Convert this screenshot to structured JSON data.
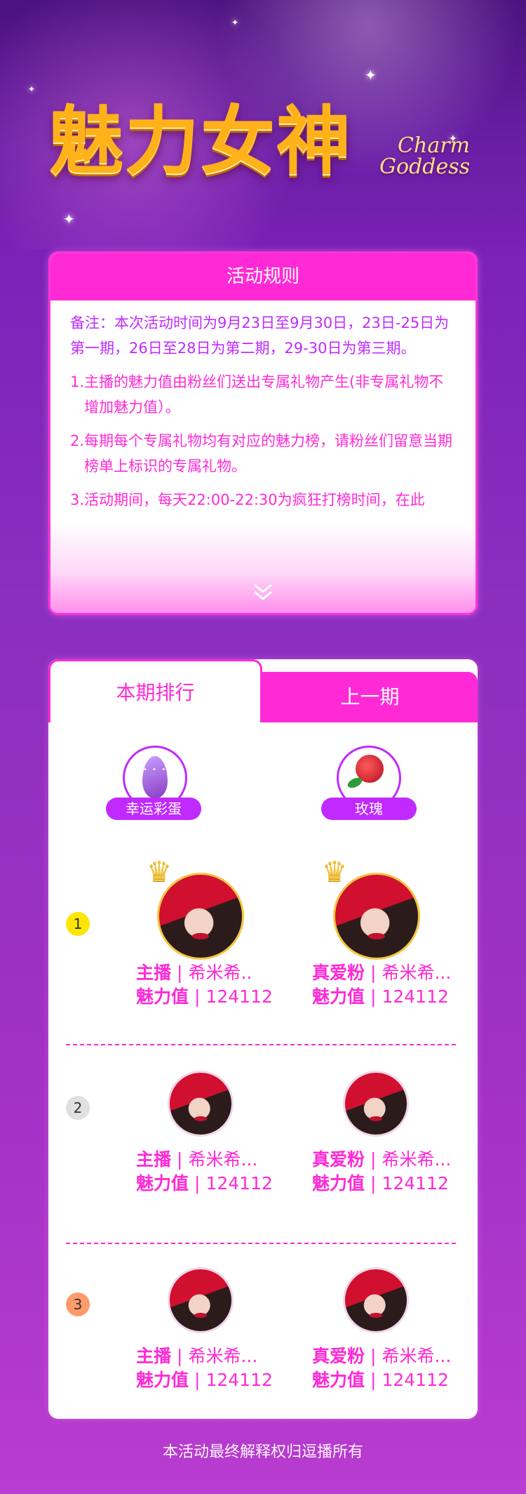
{
  "header": {
    "title_cn": "魅力女神",
    "title_en_line1": "Charm",
    "title_en_line2": "Goddess"
  },
  "rules": {
    "title": "活动规则",
    "note": "备注：本次活动时间为9月23日至9月30日，23日-25日为第一期，26日至28日为第二期，29-30日为第三期。",
    "items": [
      "1.主播的魅力值由粉丝们送出专属礼物产生(非专属礼物不增加魅力值）。",
      "2.每期每个专属礼物均有对应的魅力榜，请粉丝们留意当期榜单上标识的专属礼物。",
      "3.活动期间，每天22:00-22:30为疯狂打榜时间，在此"
    ]
  },
  "ranking": {
    "tab_current": "本期排行",
    "tab_previous": "上一期",
    "gift_left": "幸运彩蛋",
    "gift_right": "玫瑰",
    "rows": [
      {
        "rank": "1",
        "left": {
          "role": "主播",
          "name": "希米希..",
          "score_label": "魅力值",
          "score": "124112"
        },
        "right": {
          "role": "真爱粉",
          "name": "希米希...",
          "score_label": "魅力值",
          "score": "124112"
        }
      },
      {
        "rank": "2",
        "left": {
          "role": "主播",
          "name": "希米希...",
          "score_label": "魅力值",
          "score": "124112"
        },
        "right": {
          "role": "真爱粉",
          "name": "希米希...",
          "score_label": "魅力值",
          "score": "124112"
        }
      },
      {
        "rank": "3",
        "left": {
          "role": "主播",
          "name": "希米希...",
          "score_label": "魅力值",
          "score": "124112"
        },
        "right": {
          "role": "真爱粉",
          "name": "希米希...",
          "score_label": "魅力值",
          "score": "124112"
        }
      }
    ]
  },
  "footer": {
    "text": "本活动最终解释权归逗播所有"
  },
  "colors": {
    "accent": "#ff2ad6",
    "purple": "#c02aff",
    "rank1": "#ffe600",
    "rank2": "#e0e0e0",
    "rank3": "#ff9a6a"
  }
}
